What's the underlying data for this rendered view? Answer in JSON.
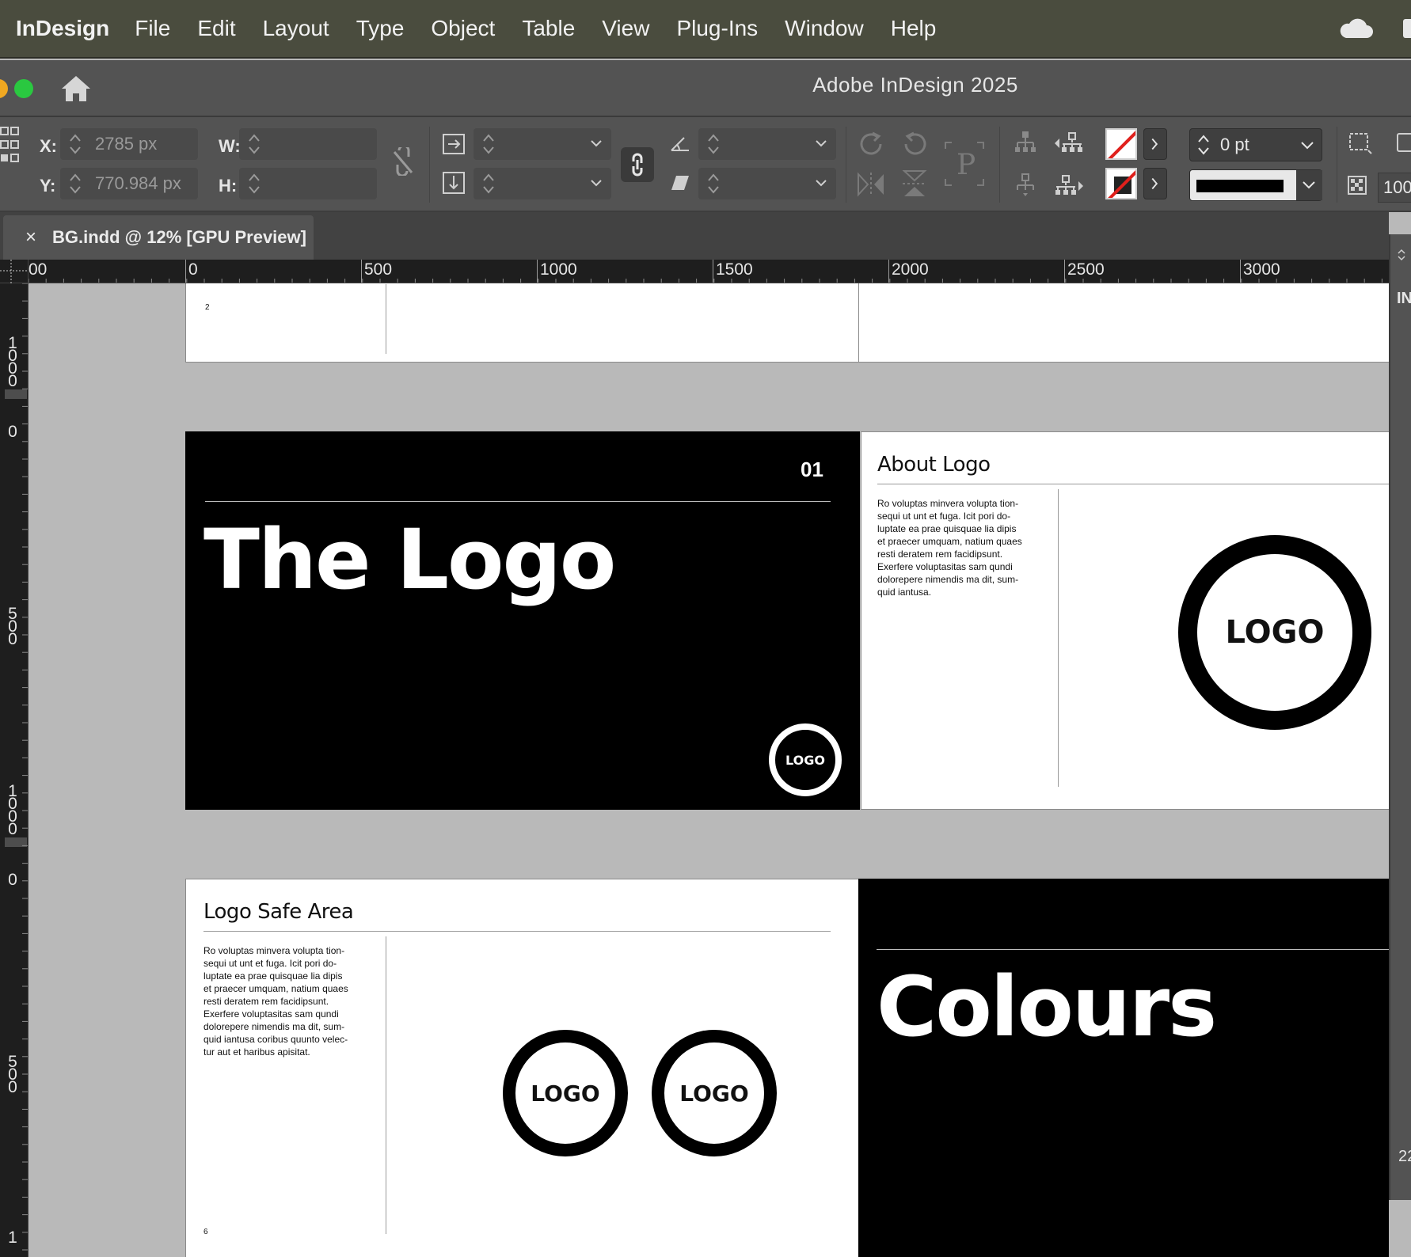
{
  "menubar": {
    "app": "InDesign",
    "items": [
      "File",
      "Edit",
      "Layout",
      "Type",
      "Object",
      "Table",
      "View",
      "Plug-Ins",
      "Window",
      "Help"
    ],
    "edge_letter": "T"
  },
  "window": {
    "title": "Adobe InDesign 2025"
  },
  "control_panel": {
    "x_label": "X:",
    "y_label": "Y:",
    "w_label": "W:",
    "h_label": "H:",
    "x_value": "2785 px",
    "y_value": "770.984 px",
    "w_value": "",
    "h_value": "",
    "stroke_weight": "0 pt",
    "opacity": "100"
  },
  "document_tab": {
    "close_glyph": "×",
    "label": "BG.indd @ 12% [GPU Preview]"
  },
  "rulers": {
    "horizontal": [
      "00",
      "0",
      "500",
      "1000",
      "1500",
      "2000",
      "2500",
      "3000"
    ],
    "vertical": [
      {
        "digits": [
          "1",
          "0",
          "0",
          "0"
        ]
      },
      {
        "digits": [
          "0"
        ]
      },
      {
        "digits": [
          "5",
          "0",
          "0"
        ]
      },
      {
        "digits": [
          "1",
          "0",
          "0",
          "0"
        ]
      },
      {
        "digits": [
          "0"
        ]
      },
      {
        "digits": [
          "5",
          "0",
          "0"
        ]
      },
      {
        "digits": [
          "1"
        ]
      }
    ]
  },
  "right_panel": {
    "top_text": "IN",
    "bottom_text": "22"
  },
  "spread1": {
    "page_number": "2"
  },
  "spread2": {
    "section_number": "01",
    "title": "The Logo",
    "small_logo": "LOGO",
    "about_heading": "About Logo",
    "about_body": [
      "Ro voluptas minvera volupta tion-",
      "sequi ut unt et fuga. Icit pori do-",
      "luptate ea prae quisquae lia dipis",
      "et praecer umquam, natium quaes",
      "resti deratem rem facidipsunt.",
      "Exerfere voluptasitas sam qundi",
      "dolorepere nimendis ma dit, sum-",
      "quid iantusa."
    ],
    "large_logo": "LOGO"
  },
  "spread3": {
    "safe_heading": "Logo Safe Area",
    "safe_body": [
      "Ro voluptas minvera volupta tion-",
      "sequi ut unt et fuga. Icit pori do-",
      "luptate ea prae quisquae lia dipis",
      "et praecer umquam, natium quaes",
      "resti deratem rem facidipsunt.",
      "Exerfere voluptasitas sam qundi",
      "dolorepere nimendis ma dit, sum-",
      "quid iantusa coribus quunto velec-",
      "tur aut et haribus apisitat."
    ],
    "logo_a": "LOGO",
    "logo_b": "LOGO",
    "page_number": "6",
    "colours_title": "Colours"
  },
  "colors": {
    "menubar_bg": "#4a4c3e",
    "chrome_bg": "#535353",
    "pasteboard": "#b9b9b9",
    "traffic_green": "#2ac840",
    "stroke_none_red": "#e0201c"
  }
}
